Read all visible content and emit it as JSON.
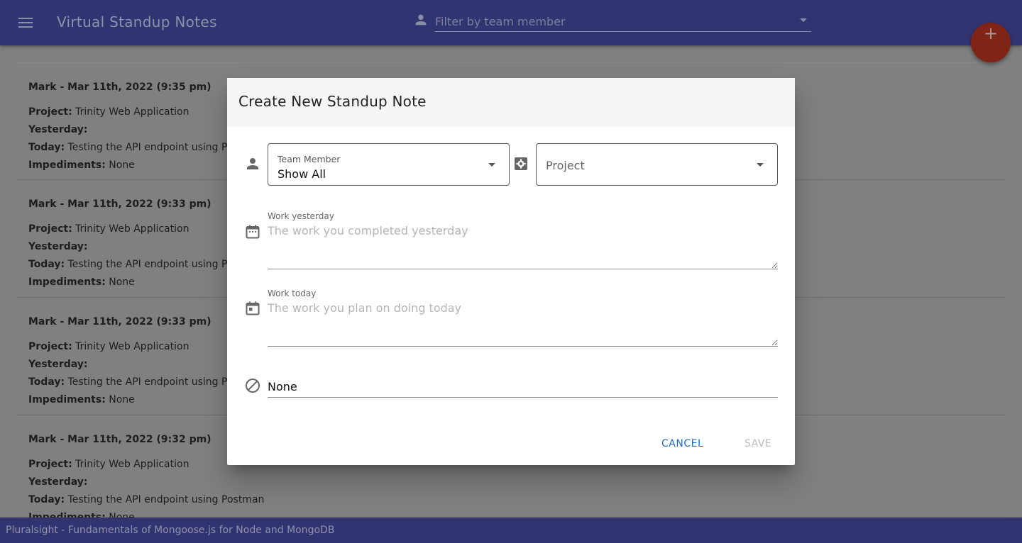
{
  "appbar": {
    "title": "Virtual Standup Notes",
    "filter_placeholder": "Filter by team member",
    "add_button": "+"
  },
  "notes": [
    {
      "title": "Mark - Mar 11th, 2022 (9:35 pm)",
      "project_label": "Project:",
      "project": "Trinity Web Application",
      "yesterday_label": "Yesterday:",
      "yesterday": "",
      "today_label": "Today:",
      "today": "Testing the API endpoint using P",
      "impediments_label": "Impediments:",
      "impediments": "None"
    },
    {
      "title": "Mark - Mar 11th, 2022 (9:33 pm)",
      "project_label": "Project:",
      "project": "Trinity Web Application",
      "yesterday_label": "Yesterday:",
      "yesterday": "",
      "today_label": "Today:",
      "today": "Testing the API endpoint using P",
      "impediments_label": "Impediments:",
      "impediments": "None"
    },
    {
      "title": "Mark - Mar 11th, 2022 (9:33 pm)",
      "project_label": "Project:",
      "project": "Trinity Web Application",
      "yesterday_label": "Yesterday:",
      "yesterday": "",
      "today_label": "Today:",
      "today": "Testing the API endpoint using P",
      "impediments_label": "Impediments:",
      "impediments": "None"
    },
    {
      "title": "Mark - Mar 11th, 2022 (9:32 pm)",
      "project_label": "Project:",
      "project": "Trinity Web Application",
      "yesterday_label": "Yesterday:",
      "yesterday": "",
      "today_label": "Today:",
      "today": "Testing the API endpoint using Postman",
      "impediments_label": "Impediments:",
      "impediments": "None"
    }
  ],
  "dialog": {
    "title": "Create New Standup Note",
    "team_member": {
      "label": "Team Member",
      "value": "Show All"
    },
    "project": {
      "placeholder": "Project"
    },
    "work_yesterday": {
      "label": "Work yesterday",
      "placeholder": "The work you completed yesterday",
      "value": ""
    },
    "work_today": {
      "label": "Work today",
      "placeholder": "The work you plan on doing today",
      "value": ""
    },
    "impediments": {
      "value": "None"
    },
    "cancel_label": "CANCEL",
    "save_label": "SAVE"
  },
  "footer": {
    "text": "Pluralsight - Fundamentals of Mongoose.js for Node and MongoDB"
  },
  "colors": {
    "appbar": "#313470",
    "fab": "#802416",
    "primary_button": "#1e6ebe",
    "disabled_button": "#bdbdbd",
    "overlay": "#7f7f7f"
  },
  "icons": {
    "menu": "menu-icon",
    "filter": "person-icon",
    "team_member": "person-icon",
    "project": "settings-box-icon",
    "work_yesterday": "calendar-icon",
    "work_today": "calendar-today-icon",
    "impediments": "block-icon"
  }
}
